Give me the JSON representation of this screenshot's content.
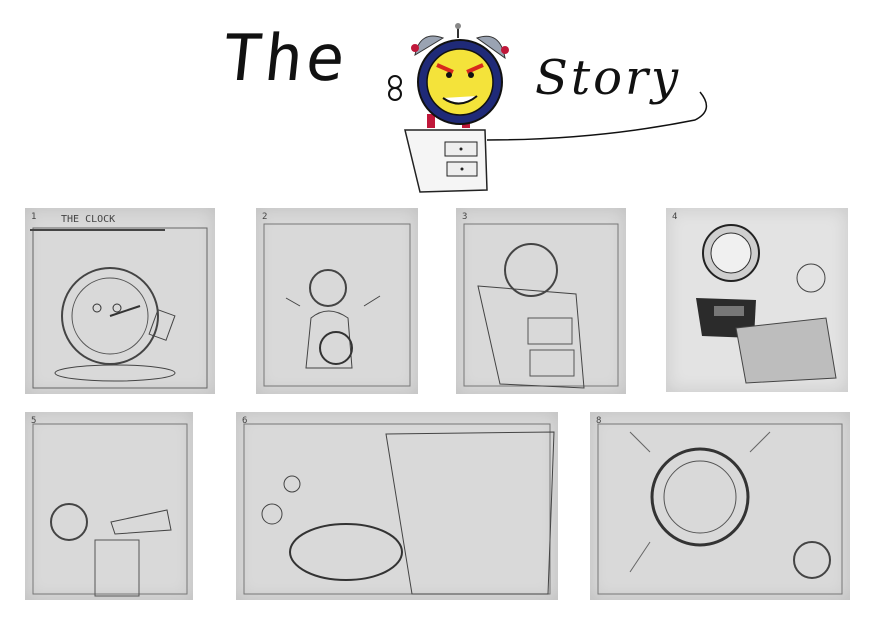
{
  "title": {
    "word1": "The",
    "word2": "Story"
  },
  "panels": [
    {
      "id": 1,
      "number": "1",
      "caption": "THE CLOCK"
    },
    {
      "id": 2,
      "number": "2"
    },
    {
      "id": 3,
      "number": "3"
    },
    {
      "id": 4,
      "number": "4"
    },
    {
      "id": 5,
      "number": "5"
    },
    {
      "id": 6,
      "number": "6"
    },
    {
      "id": 7,
      "number": "8"
    }
  ]
}
